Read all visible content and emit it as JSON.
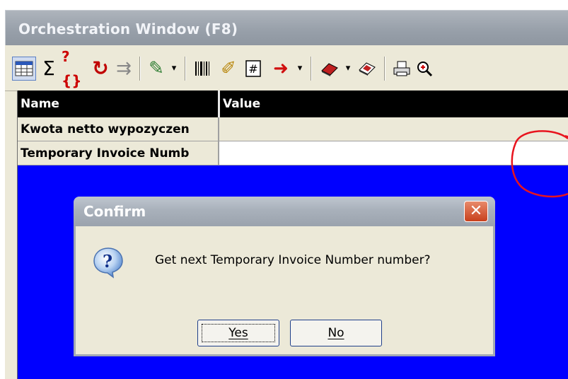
{
  "window": {
    "title": "Orchestration Window (F8)"
  },
  "toolbar": {
    "buttons": [
      {
        "icon": "grid-view-icon",
        "glyph": "▦"
      },
      {
        "icon": "sum-icon",
        "glyph": "Σ"
      },
      {
        "icon": "query-braces-icon",
        "glyph": "?{}"
      },
      {
        "icon": "refresh-icon",
        "glyph": "↻"
      },
      {
        "icon": "align-icon",
        "glyph": "⇉"
      },
      {
        "icon": "edit-document-icon",
        "glyph": "✎"
      },
      {
        "icon": "barcode-icon",
        "glyph": "‖‖"
      },
      {
        "icon": "brush-icon",
        "glyph": "✐"
      },
      {
        "icon": "number-field-icon",
        "glyph": "#"
      },
      {
        "icon": "arrow-right-icon",
        "glyph": "➜"
      },
      {
        "icon": "eraser-icon",
        "glyph": "⬙"
      },
      {
        "icon": "erase-alt-icon",
        "glyph": "⬙"
      },
      {
        "icon": "print-icon",
        "glyph": "⎙"
      },
      {
        "icon": "zoom-icon",
        "glyph": "⊕"
      }
    ],
    "dropdown_glyph": "▾"
  },
  "grid": {
    "columns": [
      "Name",
      "Value"
    ],
    "rows": [
      {
        "name": "Kwota netto wypozyczen",
        "value": ""
      },
      {
        "name": "Temporary Invoice Numb",
        "value": "",
        "ellipsis": "..."
      }
    ]
  },
  "dialog": {
    "title": "Confirm",
    "close_glyph": "✕",
    "icon": "question-icon",
    "message": "Get next Temporary Invoice Number number?",
    "yes_label": "Yes",
    "no_label": "No"
  },
  "colors": {
    "grid_background": "#0000ff",
    "header_background": "#000000",
    "annotation": "#e8141e"
  }
}
